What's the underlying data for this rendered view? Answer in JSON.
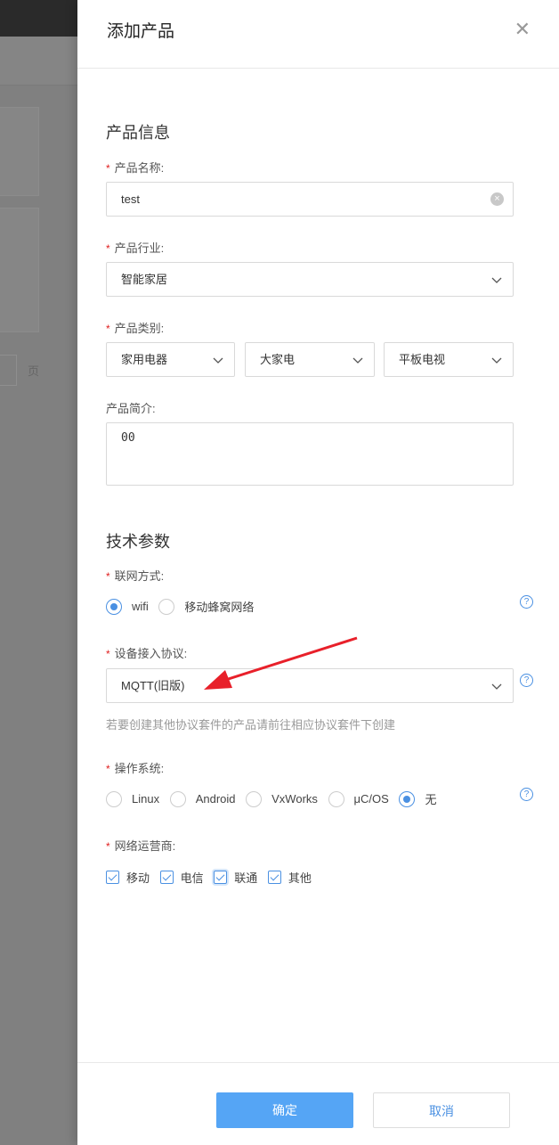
{
  "background": {
    "page_label": "页"
  },
  "drawer": {
    "title": "添加产品",
    "product_section": "产品信息",
    "name": {
      "label": "产品名称:",
      "value": "test"
    },
    "industry": {
      "label": "产品行业:",
      "value": "智能家居"
    },
    "category": {
      "label": "产品类别:",
      "values": [
        "家用电器",
        "大家电",
        "平板电视"
      ]
    },
    "description": {
      "label": "产品简介:",
      "value": "00"
    },
    "tech_section": "技术参数",
    "network": {
      "label": "联网方式:",
      "options": [
        "wifi",
        "移动蜂窝网络"
      ],
      "selected": "wifi"
    },
    "protocol": {
      "label": "设备接入协议:",
      "value": "MQTT(旧版)",
      "hint": "若要创建其他协议套件的产品请前往相应协议套件下创建"
    },
    "os": {
      "label": "操作系统:",
      "options": [
        "Linux",
        "Android",
        "VxWorks",
        "μC/OS",
        "无"
      ],
      "selected": "无"
    },
    "carrier": {
      "label": "网络运营商:",
      "options": [
        "移动",
        "电信",
        "联通",
        "其他"
      ]
    },
    "confirm": "确定",
    "cancel": "取消"
  },
  "colors": {
    "accent": "#4a90e2",
    "primary_button": "#55a5f5",
    "annotation_arrow": "#e8202a"
  }
}
